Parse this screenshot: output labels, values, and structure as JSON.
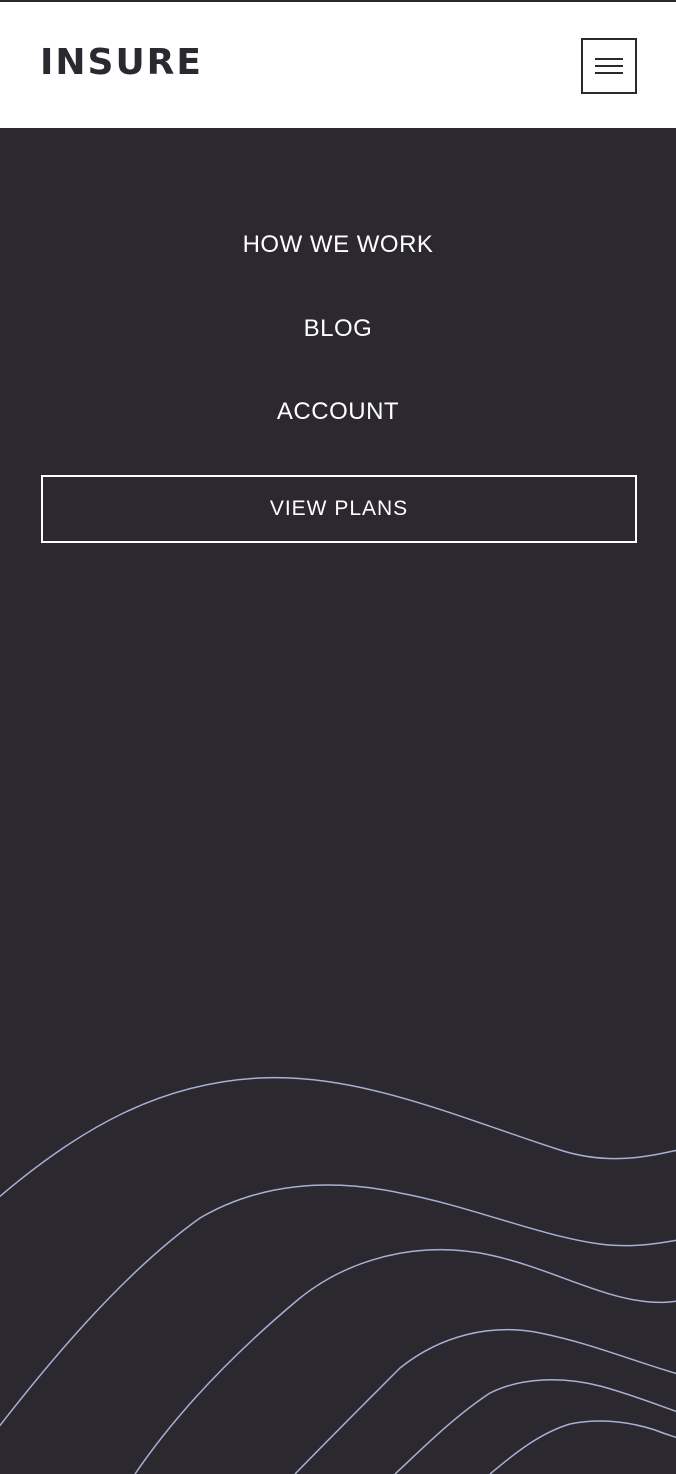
{
  "header": {
    "logo_text": "INSURE",
    "menu_icon": "hamburger-icon"
  },
  "nav": {
    "items": [
      {
        "label": "HOW WE WORK"
      },
      {
        "label": "BLOG"
      },
      {
        "label": "ACCOUNT"
      }
    ],
    "cta_label": "VIEW PLANS"
  },
  "colors": {
    "dark": "#2c2830",
    "white": "#ffffff",
    "wave_stroke": "#a7b0d4"
  }
}
